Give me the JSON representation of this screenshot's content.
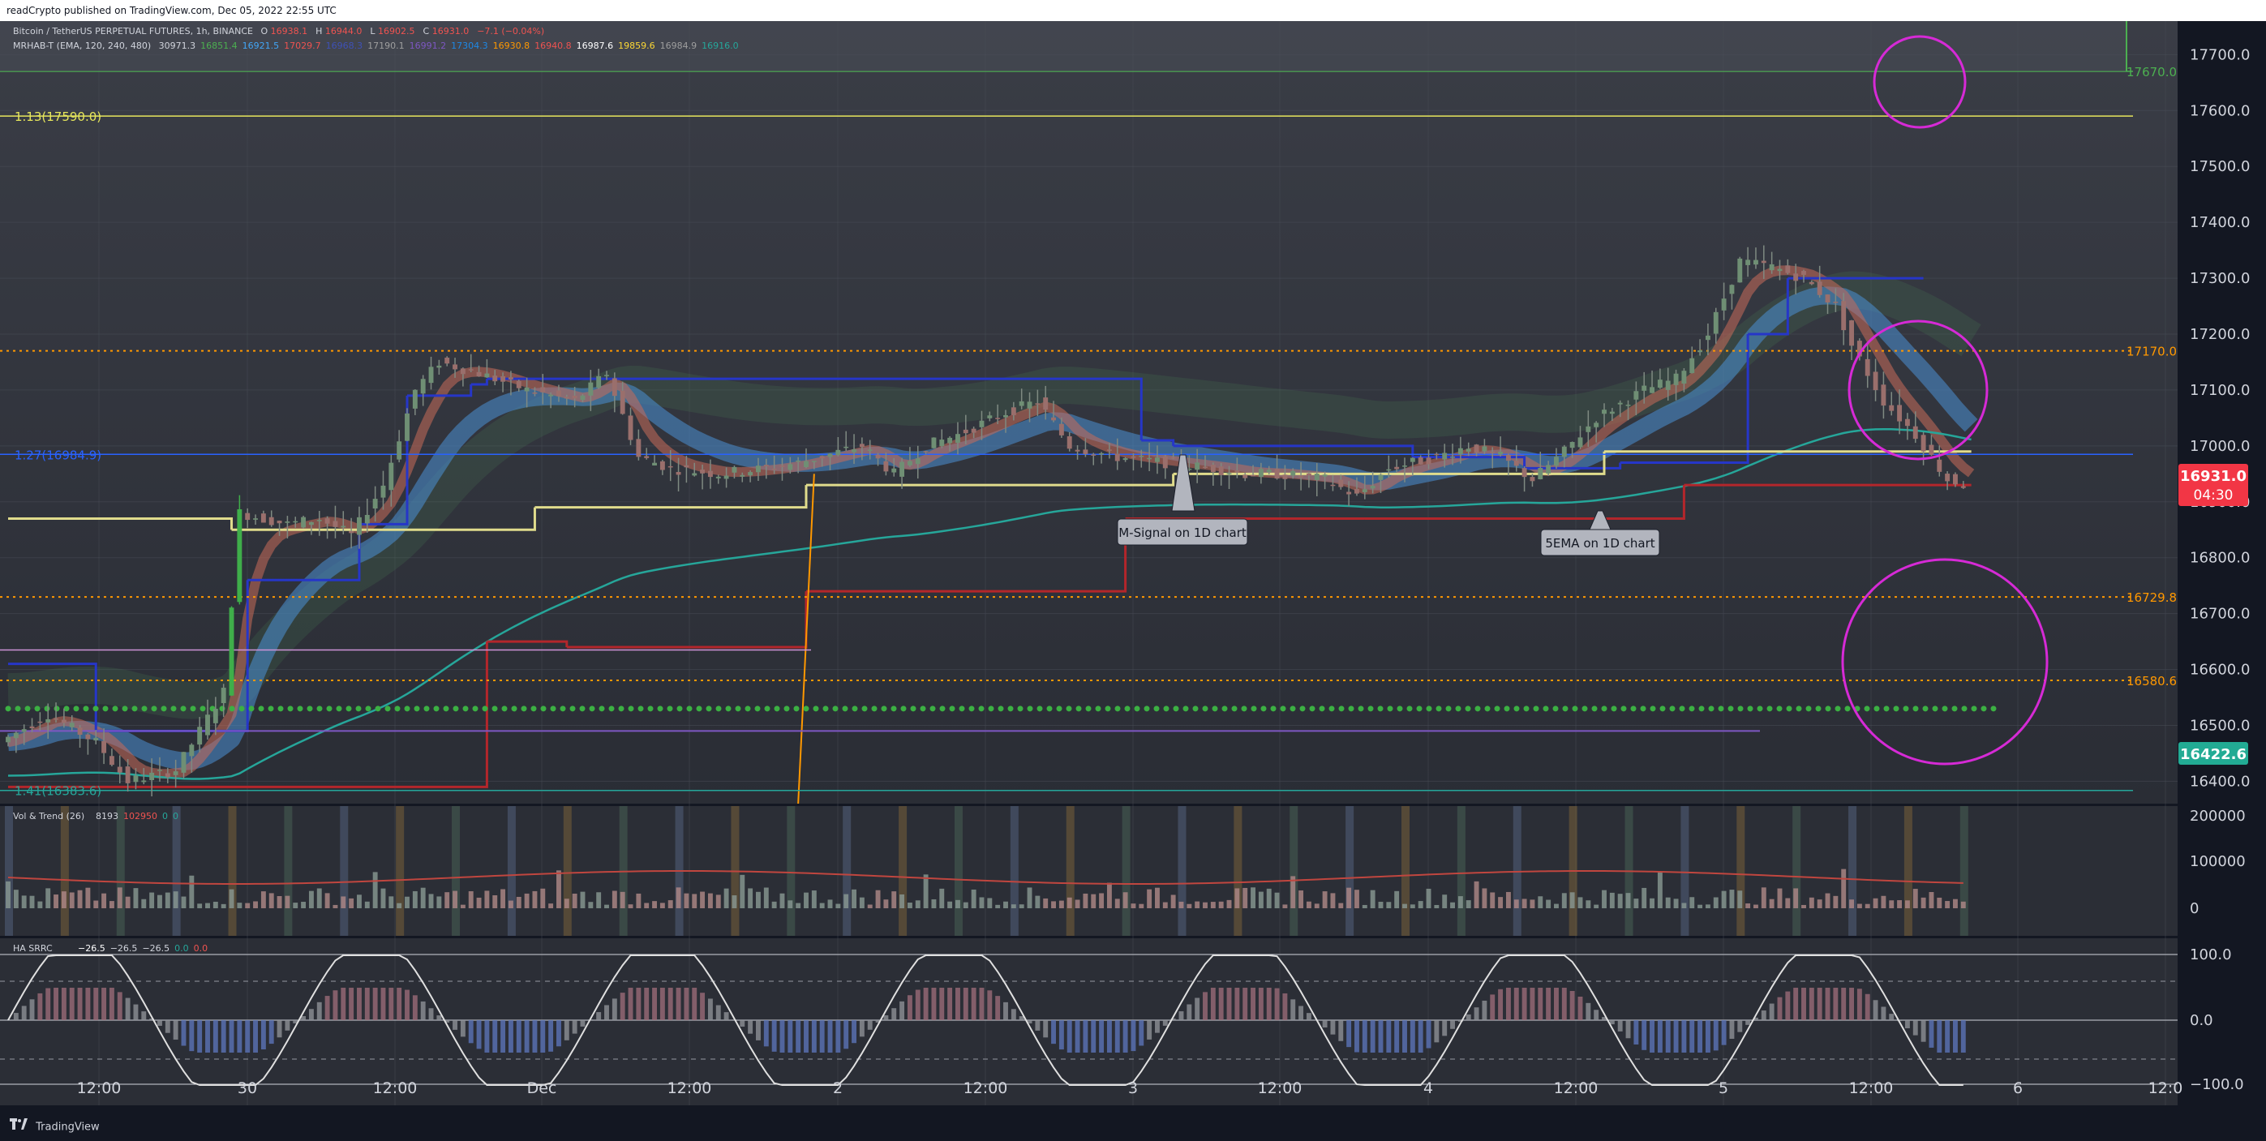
{
  "header": {
    "text": "readCrypto published on TradingView.com, Dec 05, 2022 22:55 UTC"
  },
  "footer": {
    "brand": "TradingView"
  },
  "legend": {
    "symbol": "Bitcoin / TetherUS PERPETUAL FUTURES, 1h, BINANCE",
    "ohlc": [
      {
        "k": "O",
        "v": "16938.1"
      },
      {
        "k": "H",
        "v": "16944.0"
      },
      {
        "k": "L",
        "v": "16902.5"
      },
      {
        "k": "C",
        "v": "16931.0"
      },
      {
        "k": "",
        "v": "−7.1 (−0.04%)"
      }
    ],
    "indicator": "MRHAB-T (EMA, 120, 240, 480)",
    "indicator_values": [
      {
        "v": "30971.3",
        "c": "#d1d4dc"
      },
      {
        "v": "16851.4",
        "c": "#4caf50"
      },
      {
        "v": "16921.5",
        "c": "#42a5f5"
      },
      {
        "v": "17029.7",
        "c": "#ef5350"
      },
      {
        "v": "16968.3",
        "c": "#3f51b5"
      },
      {
        "v": "17190.1",
        "c": "#9e9e9e"
      },
      {
        "v": "16991.2",
        "c": "#7e57c2"
      },
      {
        "v": "17304.3",
        "c": "#1e88e5"
      },
      {
        "v": "16930.8",
        "c": "#ff9800"
      },
      {
        "v": "16940.8",
        "c": "#ef5350"
      },
      {
        "v": "16987.6",
        "c": "#ffffff"
      },
      {
        "v": "19859.6",
        "c": "#fdd835"
      },
      {
        "v": "16984.9",
        "c": "#9e9e9e"
      },
      {
        "v": "16916.0",
        "c": "#26a69a"
      }
    ]
  },
  "price_axis": {
    "ticks": [
      "17700.0",
      "17600.0",
      "17500.0",
      "17400.0",
      "17300.0",
      "17200.0",
      "17100.0",
      "17000.0",
      "16900.0",
      "16800.0",
      "16700.0",
      "16600.0",
      "16500.0",
      "16400.0"
    ],
    "current_price": "16931.0",
    "countdown": "04:30",
    "support_price": "16422.6"
  },
  "levels": [
    {
      "label": "17670.0",
      "price": 17670,
      "color": "#4caf50",
      "style": "solid"
    },
    {
      "label": "1.13(17590.0)",
      "price": 17590,
      "color": "#e6e65c",
      "style": "solid",
      "left_label": true
    },
    {
      "label": "17170.0",
      "price": 17170,
      "color": "#ff9800",
      "style": "dotted"
    },
    {
      "label": "1.27(16984.9)",
      "price": 16984.9,
      "color": "#2962ff",
      "style": "solid",
      "left_label": true
    },
    {
      "label": "16729.8",
      "price": 16729.8,
      "color": "#ff9800",
      "style": "dotted"
    },
    {
      "label": "16580.6",
      "price": 16580.6,
      "color": "#ff9800",
      "style": "dotted"
    },
    {
      "label": "1.41(16383.6)",
      "price": 16383.6,
      "color": "#26a69a",
      "style": "solid",
      "left_label": true
    }
  ],
  "annotations": [
    {
      "text": "M-Signal on 1D chart"
    },
    {
      "text": "5EMA on 1D chart"
    }
  ],
  "vol_panel": {
    "title": "Vol & Trend (26)",
    "values": [
      {
        "v": "8193",
        "c": "#d1d4dc"
      },
      {
        "v": "102950",
        "c": "#ef5350"
      },
      {
        "v": "0",
        "c": "#26a69a"
      },
      {
        "v": "0",
        "c": "#26a69a"
      }
    ],
    "ticks": [
      "200000",
      "100000",
      "0"
    ]
  },
  "osc_panel": {
    "title": "HA SRRC",
    "values": [
      {
        "v": "−26.5",
        "c": "#ffffff"
      },
      {
        "v": "−26.5",
        "c": "#d1d4dc"
      },
      {
        "v": "−26.5",
        "c": "#d1d4dc"
      },
      {
        "v": "0.0",
        "c": "#26a69a"
      },
      {
        "v": "0.0",
        "c": "#ef5350"
      }
    ],
    "ticks": [
      "100.0",
      "0.0",
      "−100.0"
    ]
  },
  "time_axis": {
    "ticks": [
      "12:00",
      "30",
      "12:00",
      "Dec",
      "12:00",
      "2",
      "12:00",
      "3",
      "12:00",
      "4",
      "12:00",
      "5",
      "12:00",
      "6",
      "12:0"
    ]
  },
  "chart_data": {
    "type": "candlestick",
    "title": "Bitcoin / TetherUS PERPETUAL FUTURES, 1h, BINANCE",
    "timeframe": "1h",
    "ylim": [
      16360,
      17760
    ],
    "x_ticks": [
      "12:00",
      "30",
      "12:00",
      "Dec",
      "12:00",
      "2",
      "12:00",
      "3",
      "12:00",
      "4",
      "12:00",
      "5",
      "12:00",
      "6",
      "12:0"
    ],
    "series": [
      {
        "name": "price",
        "points": [
          [
            0,
            16470
          ],
          [
            6,
            16520
          ],
          [
            12,
            16470
          ],
          [
            16,
            16400
          ],
          [
            22,
            16420
          ],
          [
            28,
            16560
          ],
          [
            30,
            16880
          ],
          [
            36,
            16860
          ],
          [
            40,
            16870
          ],
          [
            44,
            16840
          ],
          [
            48,
            16930
          ],
          [
            52,
            17100
          ],
          [
            55,
            17150
          ],
          [
            60,
            17130
          ],
          [
            66,
            17100
          ],
          [
            72,
            17080
          ],
          [
            76,
            17130
          ],
          [
            80,
            16980
          ],
          [
            84,
            16960
          ],
          [
            90,
            16950
          ],
          [
            96,
            16960
          ],
          [
            100,
            16970
          ],
          [
            108,
            17000
          ],
          [
            112,
            16950
          ],
          [
            116,
            17000
          ],
          [
            120,
            17020
          ],
          [
            126,
            17060
          ],
          [
            130,
            17080
          ],
          [
            134,
            17000
          ],
          [
            140,
            16980
          ],
          [
            146,
            16970
          ],
          [
            152,
            16960
          ],
          [
            156,
            16950
          ],
          [
            160,
            16950
          ],
          [
            166,
            16940
          ],
          [
            170,
            16910
          ],
          [
            174,
            16960
          ],
          [
            180,
            16980
          ],
          [
            184,
            17000
          ],
          [
            188,
            16980
          ],
          [
            192,
            16940
          ],
          [
            196,
            16990
          ],
          [
            200,
            17050
          ],
          [
            206,
            17100
          ],
          [
            210,
            17120
          ],
          [
            214,
            17200
          ],
          [
            218,
            17330
          ],
          [
            222,
            17320
          ],
          [
            226,
            17300
          ],
          [
            230,
            17250
          ],
          [
            232,
            17180
          ],
          [
            236,
            17080
          ],
          [
            240,
            17020
          ],
          [
            244,
            16940
          ],
          [
            246,
            16931
          ]
        ]
      }
    ]
  }
}
